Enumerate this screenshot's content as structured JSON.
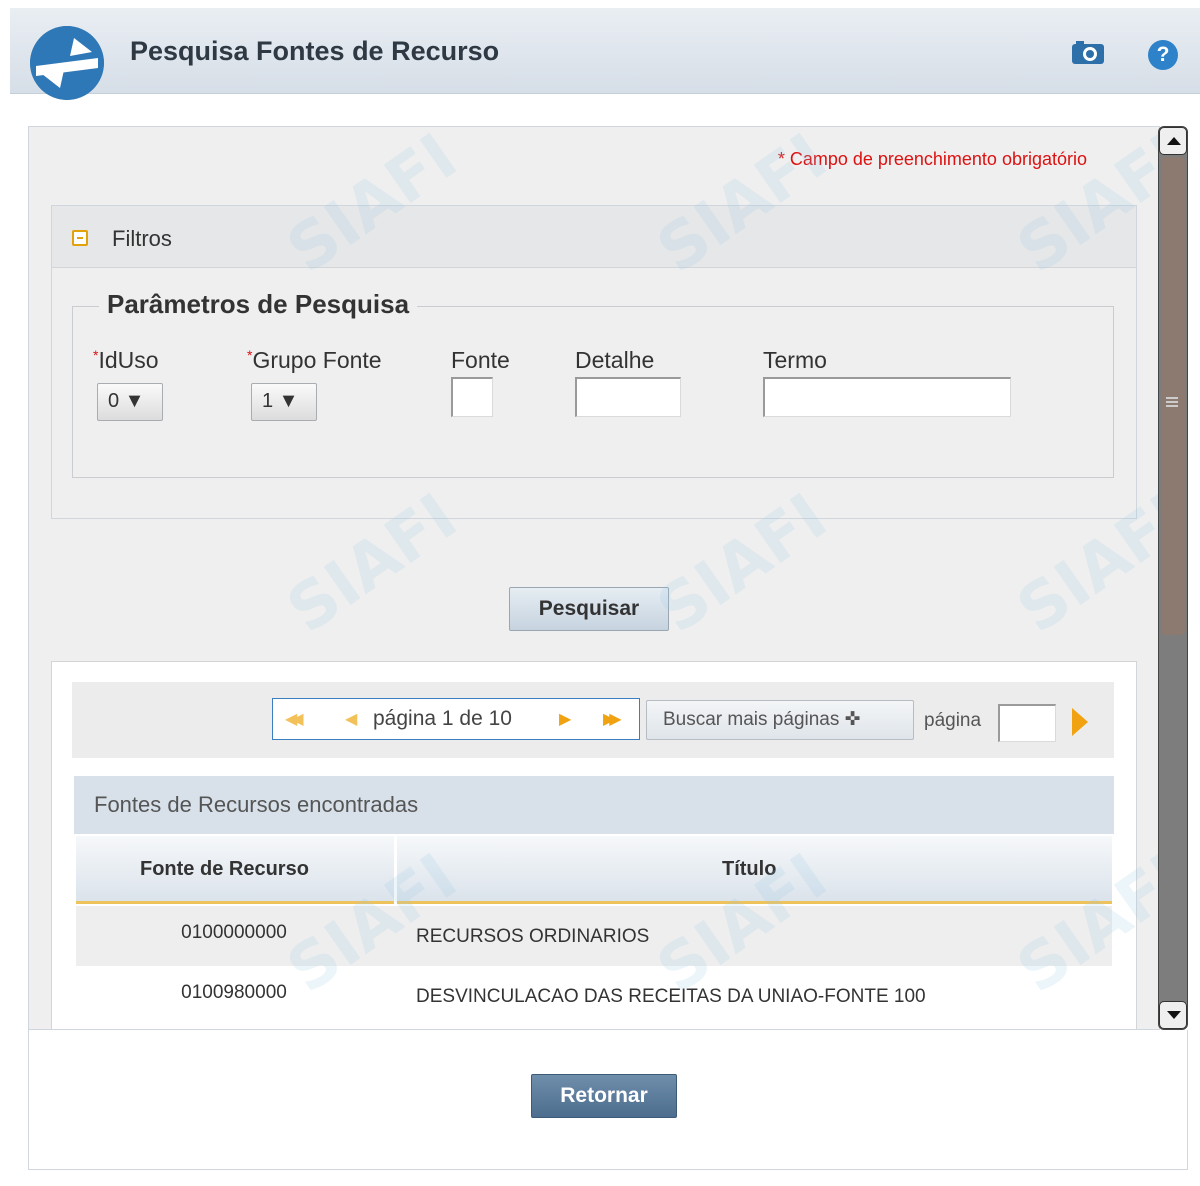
{
  "header": {
    "title": "Pesquisa Fontes de Recurso",
    "help_glyph": "?"
  },
  "form": {
    "required_note": "* Campo de preenchimento obrigatório",
    "filters_label": "Filtros",
    "params_legend": "Parâmetros de Pesquisa",
    "fields": {
      "iduso_label": "IdUso",
      "iduso_value": "0 ▼",
      "grupo_label": "Grupo Fonte",
      "grupo_value": "1 ▼",
      "fonte_label": "Fonte",
      "detalhe_label": "Detalhe",
      "termo_label": "Termo"
    },
    "search_button": "Pesquisar"
  },
  "results": {
    "pager": {
      "text": "página 1 de 10",
      "more_pages": "Buscar mais páginas ✜",
      "page_label": "página"
    },
    "title": "Fontes de Recursos encontradas",
    "columns": [
      "Fonte de Recurso",
      "Título"
    ],
    "rows": [
      {
        "fonte": "0100000000",
        "titulo": "RECURSOS ORDINARIOS"
      },
      {
        "fonte": "0100980000",
        "titulo": "DESVINCULACAO DAS RECEITAS DA UNIAO-FONTE 100"
      }
    ]
  },
  "footer": {
    "return_button": "Retornar"
  },
  "watermark": "SIAFI",
  "colors": {
    "required": "#dd1111",
    "accent": "#f0a210",
    "primary_button": "#4d6d8e"
  }
}
